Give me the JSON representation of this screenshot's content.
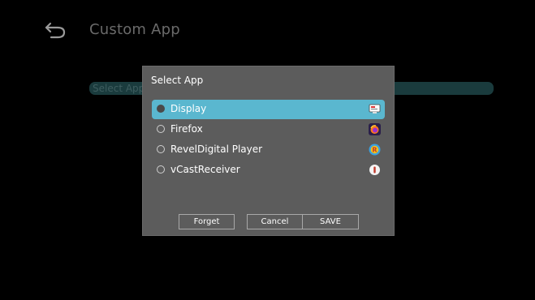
{
  "header": {
    "title": "Custom App"
  },
  "background": {
    "field_label": "Select App"
  },
  "dialog": {
    "title": "Select App",
    "options": [
      {
        "label": "Display",
        "icon": "display-app-icon",
        "selected": true
      },
      {
        "label": "Firefox",
        "icon": "firefox-icon",
        "selected": false
      },
      {
        "label": "RevelDigital Player",
        "icon": "reveldigital-icon",
        "selected": false
      },
      {
        "label": "vCastReceiver",
        "icon": "vcast-icon",
        "selected": false
      }
    ],
    "buttons": {
      "forget": "Forget",
      "cancel": "Cancel",
      "save": "SAVE"
    }
  },
  "colors": {
    "selected_highlight": "#5ab7cf",
    "dialog_bg": "#5c5c5c",
    "screen_bg": "#000000"
  }
}
